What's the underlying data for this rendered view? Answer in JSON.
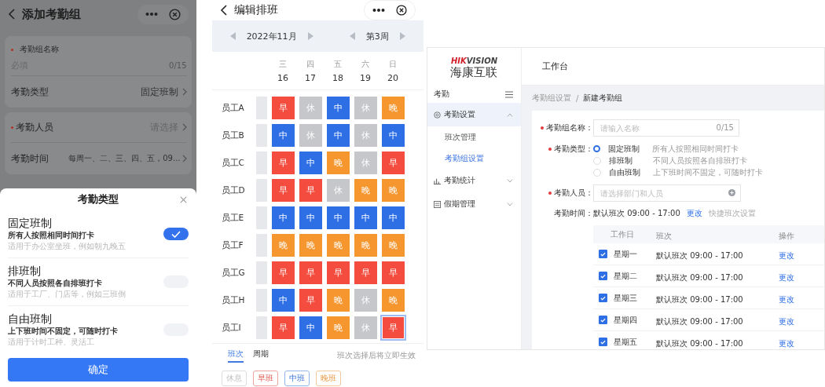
{
  "left": {
    "title": "添加考勤组",
    "form": {
      "name": {
        "label": "考勤组名称",
        "placeholder": "必填",
        "count": "0/15",
        "required": true
      },
      "type": {
        "label": "考勤类型",
        "value": "固定班制"
      },
      "people": {
        "label": "考勤人员",
        "placeholder": "请选择",
        "required": true
      },
      "time": {
        "label": "考勤时间",
        "value": "每周一、二、三、四、五，09..."
      }
    },
    "sheet": {
      "title": "考勤类型",
      "confirm": "确定",
      "options": [
        {
          "title": "固定班制",
          "desc": "所有人按照相同时间打卡",
          "hint": "适用于办公室坐班，例如朝九晚五",
          "selected": true
        },
        {
          "title": "排班制",
          "desc": "不同人员按照各自排班打卡",
          "hint": "适用于工厂、门店等，例如三班倒",
          "selected": false
        },
        {
          "title": "自由班制",
          "desc": "上下班时间不固定，可随时打卡",
          "hint": "适用于计时工种、灵活工",
          "selected": false
        }
      ]
    }
  },
  "schedule": {
    "title": "编辑排班",
    "month": "2022年11月",
    "week": "第3周",
    "days": [
      {
        "weekday": "三",
        "date": "16"
      },
      {
        "weekday": "四",
        "date": "17"
      },
      {
        "weekday": "五",
        "date": "18"
      },
      {
        "weekday": "六",
        "date": "19"
      },
      {
        "weekday": "日",
        "date": "20"
      }
    ],
    "employees": [
      {
        "name": "员工A",
        "shifts": [
          {
            "kind": "early",
            "label": "早",
            "selected": false
          },
          {
            "kind": "rest",
            "label": "休",
            "selected": false
          },
          {
            "kind": "mid",
            "label": "中",
            "selected": false
          },
          {
            "kind": "rest",
            "label": "休",
            "selected": false
          },
          {
            "kind": "late",
            "label": "晚",
            "selected": false
          }
        ]
      },
      {
        "name": "员工B",
        "shifts": [
          {
            "kind": "mid",
            "label": "中",
            "selected": false
          },
          {
            "kind": "rest",
            "label": "休",
            "selected": false
          },
          {
            "kind": "mid",
            "label": "中",
            "selected": false
          },
          {
            "kind": "rest",
            "label": "休",
            "selected": false
          },
          {
            "kind": "mid",
            "label": "中",
            "selected": false
          }
        ]
      },
      {
        "name": "员工C",
        "shifts": [
          {
            "kind": "early",
            "label": "早",
            "selected": false
          },
          {
            "kind": "mid",
            "label": "中",
            "selected": false
          },
          {
            "kind": "late",
            "label": "晚",
            "selected": false
          },
          {
            "kind": "rest",
            "label": "休",
            "selected": false
          },
          {
            "kind": "early",
            "label": "早",
            "selected": false
          }
        ]
      },
      {
        "name": "员工D",
        "shifts": [
          {
            "kind": "early",
            "label": "早",
            "selected": false
          },
          {
            "kind": "early",
            "label": "早",
            "selected": false
          },
          {
            "kind": "rest",
            "label": "休",
            "selected": false
          },
          {
            "kind": "late",
            "label": "晚",
            "selected": false
          },
          {
            "kind": "late",
            "label": "晚",
            "selected": false
          }
        ]
      },
      {
        "name": "员工E",
        "shifts": [
          {
            "kind": "mid",
            "label": "中",
            "selected": false
          },
          {
            "kind": "mid",
            "label": "中",
            "selected": false
          },
          {
            "kind": "mid",
            "label": "中",
            "selected": false
          },
          {
            "kind": "mid",
            "label": "中",
            "selected": false
          },
          {
            "kind": "mid",
            "label": "中",
            "selected": false
          }
        ]
      },
      {
        "name": "员工F",
        "shifts": [
          {
            "kind": "late",
            "label": "晚",
            "selected": false
          },
          {
            "kind": "late",
            "label": "晚",
            "selected": false
          },
          {
            "kind": "late",
            "label": "晚",
            "selected": false
          },
          {
            "kind": "late",
            "label": "晚",
            "selected": false
          },
          {
            "kind": "late",
            "label": "晚",
            "selected": false
          }
        ]
      },
      {
        "name": "员工G",
        "shifts": [
          {
            "kind": "early",
            "label": "早",
            "selected": false
          },
          {
            "kind": "early",
            "label": "早",
            "selected": false
          },
          {
            "kind": "early",
            "label": "早",
            "selected": false
          },
          {
            "kind": "early",
            "label": "早",
            "selected": false
          },
          {
            "kind": "early",
            "label": "早",
            "selected": false
          }
        ]
      },
      {
        "name": "员工H",
        "shifts": [
          {
            "kind": "mid",
            "label": "中",
            "selected": false
          },
          {
            "kind": "early",
            "label": "早",
            "selected": false
          },
          {
            "kind": "late",
            "label": "晚",
            "selected": false
          },
          {
            "kind": "rest",
            "label": "休",
            "selected": false
          },
          {
            "kind": "late",
            "label": "晚",
            "selected": false
          }
        ]
      },
      {
        "name": "员工I",
        "shifts": [
          {
            "kind": "early",
            "label": "早",
            "selected": false
          },
          {
            "kind": "mid",
            "label": "中",
            "selected": false
          },
          {
            "kind": "late",
            "label": "晚",
            "selected": false
          },
          {
            "kind": "rest",
            "label": "休",
            "selected": false
          },
          {
            "kind": "early",
            "label": "早",
            "selected": true
          }
        ]
      }
    ],
    "tabs": [
      {
        "label": "班次",
        "selected": true
      },
      {
        "label": "周期",
        "selected": false
      }
    ],
    "hint": "班次选择后将立即生效",
    "legend": [
      {
        "kind": "rest",
        "label": "休息"
      },
      {
        "kind": "early",
        "label": "早班"
      },
      {
        "kind": "mid",
        "label": "中班"
      },
      {
        "kind": "late",
        "label": "晚班"
      }
    ]
  },
  "admin": {
    "logo": {
      "red_part": "HIK",
      "rest": "VISION",
      "name": "海康互联"
    },
    "header_title": "工作台",
    "sidebar": {
      "title": "考勤",
      "items": [
        {
          "label": "考勤设置",
          "kind": "gear",
          "expanded": true,
          "children": [
            {
              "label": "班次管理",
              "selected": false
            },
            {
              "label": "考勤组设置",
              "selected": true
            }
          ]
        },
        {
          "label": "考勤统计",
          "kind": "chart",
          "expanded": false
        },
        {
          "label": "假期管理",
          "kind": "list",
          "expanded": false
        }
      ]
    },
    "breadcrumb": {
      "items": [
        "考勤组设置",
        "新建考勤组"
      ],
      "separator": "/"
    },
    "form": {
      "name": {
        "label": "考勤组名称：",
        "placeholder": "请输入名称",
        "count": "0/15",
        "required": true
      },
      "type": {
        "label": "考勤类型：",
        "required": true,
        "options": [
          {
            "label": "固定班制",
            "hint": "所有人按照相同时间打卡",
            "selected": true
          },
          {
            "label": "排班制",
            "hint": "不同人员按照各自排班打卡",
            "selected": false
          },
          {
            "label": "自由班制",
            "hint": "上下班时间不固定，可随时打卡",
            "selected": false
          }
        ]
      },
      "people": {
        "label": "考勤人员：",
        "placeholder": "请选择部门和人员",
        "required": true
      },
      "time": {
        "label": "考勤时间：",
        "value": "默认班次 09:00 - 17:00",
        "link": "更改",
        "hint": "快捷班次设置"
      }
    },
    "table": {
      "columns": [
        "工作日",
        "班次",
        "操作"
      ],
      "rows": [
        {
          "checked": true,
          "day": "星期一",
          "shift": "默认班次 09:00 - 17:00",
          "action": "更改"
        },
        {
          "checked": true,
          "day": "星期二",
          "shift": "默认班次 09:00 - 17:00",
          "action": "更改"
        },
        {
          "checked": true,
          "day": "星期三",
          "shift": "默认班次 09:00 - 17:00",
          "action": "更改"
        },
        {
          "checked": true,
          "day": "星期四",
          "shift": "默认班次 09:00 - 17:00",
          "action": "更改"
        },
        {
          "checked": true,
          "day": "星期五",
          "shift": "默认班次 09:00 - 17:00",
          "action": "更改"
        }
      ]
    }
  }
}
